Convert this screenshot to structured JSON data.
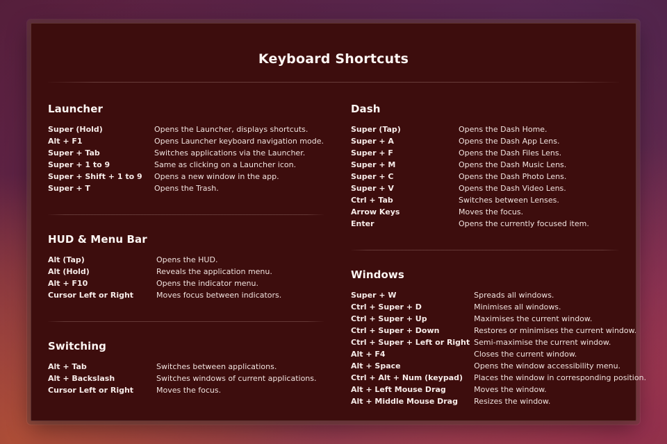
{
  "overlay": {
    "title": "Keyboard Shortcuts"
  },
  "columns": {
    "left": [
      {
        "title": "Launcher",
        "divider_above": false,
        "rows": [
          {
            "key": "Super (Hold)",
            "desc": "Opens the Launcher, displays shortcuts."
          },
          {
            "key": "Alt + F1",
            "desc": "Opens Launcher keyboard navigation mode."
          },
          {
            "key": "Super + Tab",
            "desc": "Switches applications via the Launcher."
          },
          {
            "key": "Super + 1 to 9",
            "desc": "Same as clicking on a Launcher icon."
          },
          {
            "key": "Super + Shift + 1 to 9",
            "desc": "Opens a new window in the app."
          },
          {
            "key": "Super + T",
            "desc": "Opens the Trash."
          }
        ]
      },
      {
        "title": "HUD & Menu Bar",
        "divider_above": true,
        "rows": [
          {
            "key": "Alt (Tap)",
            "desc": "Opens the HUD."
          },
          {
            "key": "Alt (Hold)",
            "desc": "Reveals the application menu."
          },
          {
            "key": "Alt + F10",
            "desc": "Opens the indicator menu."
          },
          {
            "key": "Cursor Left or Right",
            "desc": "Moves focus between indicators."
          }
        ]
      },
      {
        "title": "Switching",
        "divider_above": true,
        "rows": [
          {
            "key": "Alt + Tab",
            "desc": "Switches between applications."
          },
          {
            "key": "Alt + Backslash",
            "desc": "Switches windows of current applications."
          },
          {
            "key": "Cursor Left or Right",
            "desc": "Moves the focus."
          }
        ]
      }
    ],
    "right": [
      {
        "title": "Dash",
        "divider_above": false,
        "rows": [
          {
            "key": "Super (Tap)",
            "desc": "Opens the Dash Home."
          },
          {
            "key": "Super + A",
            "desc": "Opens the Dash App Lens."
          },
          {
            "key": "Super + F",
            "desc": "Opens the Dash Files Lens."
          },
          {
            "key": "Super + M",
            "desc": "Opens the Dash Music Lens."
          },
          {
            "key": "Super + C",
            "desc": "Opens the Dash Photo Lens."
          },
          {
            "key": "Super + V",
            "desc": "Opens the Dash Video Lens."
          },
          {
            "key": "Ctrl + Tab",
            "desc": "Switches between Lenses."
          },
          {
            "key": "Arrow Keys",
            "desc": "Moves the focus."
          },
          {
            "key": "Enter",
            "desc": "Opens the currently focused item."
          }
        ]
      },
      {
        "title": "Windows",
        "divider_above": true,
        "rows": [
          {
            "key": "Super + W",
            "desc": "Spreads all windows."
          },
          {
            "key": "Ctrl + Super + D",
            "desc": "Minimises all windows."
          },
          {
            "key": "Ctrl + Super + Up",
            "desc": "Maximises the current window."
          },
          {
            "key": "Ctrl + Super + Down",
            "desc": "Restores or minimises the current window."
          },
          {
            "key": "Ctrl + Super + Left or Right",
            "desc": "Semi-maximise the current window."
          },
          {
            "key": "Alt + F4",
            "desc": "Closes the current window."
          },
          {
            "key": "Alt + Space",
            "desc": "Opens the window accessibility menu."
          },
          {
            "key": "Ctrl + Alt + Num (keypad)",
            "desc": "Places the window in corresponding position."
          },
          {
            "key": "Alt + Left Mouse Drag",
            "desc": "Moves the window."
          },
          {
            "key": "Alt + Middle Mouse Drag",
            "desc": "Resizes the window."
          }
        ]
      }
    ]
  },
  "colors": {
    "panel_background": "#3d0d0d",
    "title_text": "#fdf6f3",
    "key_text": "#f7ece9",
    "description_text": "#f0e2de",
    "divider": "#7a4038",
    "wallpaper_purple": "#5c2140",
    "wallpaper_magenta": "#a03058",
    "wallpaper_orange": "#b0543c"
  }
}
